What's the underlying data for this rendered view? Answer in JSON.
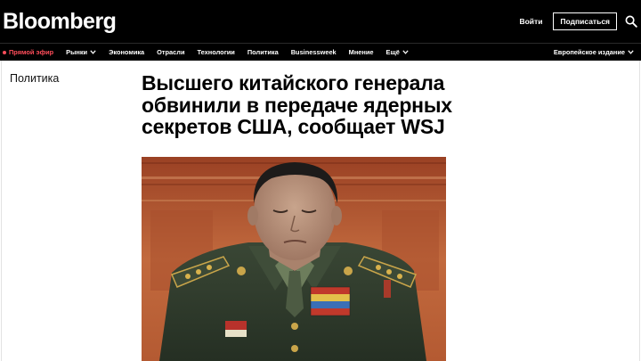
{
  "header": {
    "logo": "Bloomberg",
    "login": "Войти",
    "subscribe": "Подписаться",
    "search_icon": "search-icon"
  },
  "nav": {
    "live": "Прямой эфир",
    "items": [
      {
        "label": "Рынки",
        "has_dropdown": true
      },
      {
        "label": "Экономика"
      },
      {
        "label": "Отрасли"
      },
      {
        "label": "Технологии"
      },
      {
        "label": "Политика"
      },
      {
        "label": "Businessweek"
      },
      {
        "label": "Мнение"
      },
      {
        "label": "Ещё",
        "has_dropdown": true
      }
    ],
    "edition": "Европейское издание"
  },
  "article": {
    "section": "Политика",
    "headline": "Высшего китайского генерала обвинили в передаче ядерных секретов США, сообщает WSJ"
  },
  "colors": {
    "bar": "#000000",
    "live_accent": "#ff4d5a",
    "uniform": "#2f3b2c",
    "background_wall": "#b85a33"
  }
}
